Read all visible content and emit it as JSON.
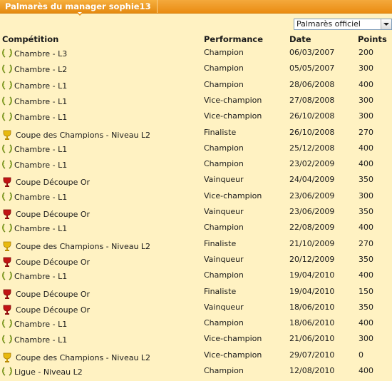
{
  "header": {
    "title": "Palmarès du manager sophie13"
  },
  "filter": {
    "selected": "Palmarès officiel"
  },
  "columns": {
    "competition": "Compétition",
    "performance": "Performance",
    "date": "Date",
    "points": "Points"
  },
  "rows": [
    {
      "competition": "Chambre - L3",
      "performance": "Champion",
      "date": "06/03/2007",
      "points": "200",
      "icon": "laurel-icon"
    },
    {
      "competition": "Chambre - L2",
      "performance": "Champion",
      "date": "05/05/2007",
      "points": "300",
      "icon": "laurel-icon"
    },
    {
      "competition": "Chambre - L1",
      "performance": "Champion",
      "date": "28/06/2008",
      "points": "400",
      "icon": "laurel-icon"
    },
    {
      "competition": "Chambre - L1",
      "performance": "Vice-champion",
      "date": "27/08/2008",
      "points": "300",
      "icon": "laurel-icon"
    },
    {
      "competition": "Chambre - L1",
      "performance": "Vice-champion",
      "date": "26/10/2008",
      "points": "300",
      "icon": "laurel-icon"
    },
    {
      "competition": "Coupe des Champions - Niveau L2",
      "performance": "Finaliste",
      "date": "26/10/2008",
      "points": "270",
      "icon": "gold-cup-icon"
    },
    {
      "competition": "Chambre - L1",
      "performance": "Champion",
      "date": "25/12/2008",
      "points": "400",
      "icon": "laurel-icon"
    },
    {
      "competition": "Chambre - L1",
      "performance": "Champion",
      "date": "23/02/2009",
      "points": "400",
      "icon": "laurel-icon"
    },
    {
      "competition": "Coupe Découpe Or",
      "performance": "Vainqueur",
      "date": "24/04/2009",
      "points": "350",
      "icon": "red-cup-icon"
    },
    {
      "competition": "Chambre - L1",
      "performance": "Vice-champion",
      "date": "23/06/2009",
      "points": "300",
      "icon": "laurel-icon"
    },
    {
      "competition": "Coupe Découpe Or",
      "performance": "Vainqueur",
      "date": "23/06/2009",
      "points": "350",
      "icon": "red-cup-icon"
    },
    {
      "competition": "Chambre - L1",
      "performance": "Champion",
      "date": "22/08/2009",
      "points": "400",
      "icon": "laurel-icon"
    },
    {
      "competition": "Coupe des Champions - Niveau L2",
      "performance": "Finaliste",
      "date": "21/10/2009",
      "points": "270",
      "icon": "gold-cup-icon"
    },
    {
      "competition": "Coupe Découpe Or",
      "performance": "Vainqueur",
      "date": "20/12/2009",
      "points": "350",
      "icon": "red-cup-icon"
    },
    {
      "competition": "Chambre - L1",
      "performance": "Champion",
      "date": "19/04/2010",
      "points": "400",
      "icon": "laurel-icon"
    },
    {
      "competition": "Coupe Découpe Or",
      "performance": "Finaliste",
      "date": "19/04/2010",
      "points": "150",
      "icon": "red-cup-icon"
    },
    {
      "competition": "Coupe Découpe Or",
      "performance": "Vainqueur",
      "date": "18/06/2010",
      "points": "350",
      "icon": "red-cup-icon"
    },
    {
      "competition": "Chambre - L1",
      "performance": "Champion",
      "date": "18/06/2010",
      "points": "400",
      "icon": "laurel-icon"
    },
    {
      "competition": "Chambre - L1",
      "performance": "Vice-champion",
      "date": "21/06/2010",
      "points": "300",
      "icon": "laurel-icon"
    },
    {
      "competition": "Coupe des Champions - Niveau L2",
      "performance": "Vice-champion",
      "date": "29/07/2010",
      "points": "0",
      "icon": "gold-cup-icon"
    },
    {
      "competition": "Ligue - Niveau L2",
      "performance": "Champion",
      "date": "12/08/2010",
      "points": "400",
      "icon": "laurel-icon"
    }
  ]
}
